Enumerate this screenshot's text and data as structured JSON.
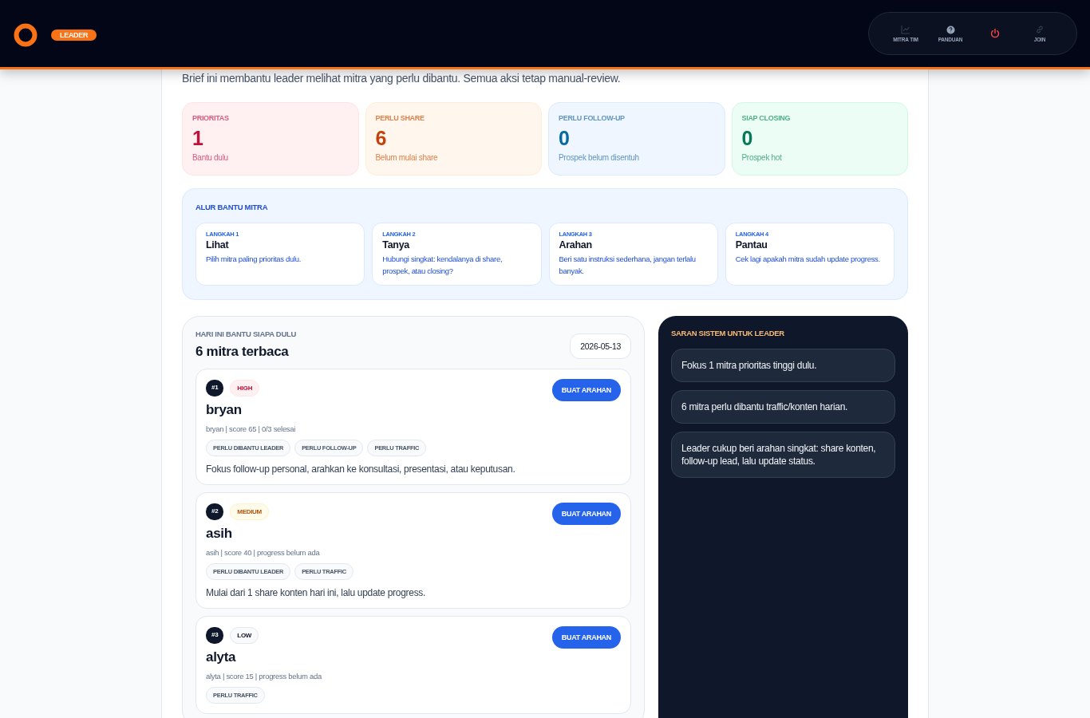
{
  "header": {
    "role_badge": "LEADER",
    "nav": [
      {
        "kind": "chart",
        "label": "MITRA TIM"
      },
      {
        "kind": "help",
        "label": "PANDUAN"
      },
      {
        "kind": "power"
      },
      {
        "kind": "link",
        "label": "JOIN"
      }
    ]
  },
  "brief": "Brief ini membantu leader melihat mitra yang perlu dibantu. Semua aksi tetap manual-review.",
  "stats": [
    {
      "kind": "rose",
      "label": "PRIORITAS",
      "value": "1",
      "note": "Bantu dulu"
    },
    {
      "kind": "orange",
      "label": "PERLU SHARE",
      "value": "6",
      "note": "Belum mulai share"
    },
    {
      "kind": "blue",
      "label": "PERLU FOLLOW-UP",
      "value": "0",
      "note": "Prospek belum disentuh"
    },
    {
      "kind": "green",
      "label": "SIAP CLOSING",
      "value": "0",
      "note": "Prospek hot"
    }
  ],
  "flow": {
    "title": "ALUR BANTU MITRA",
    "steps": [
      {
        "step": "LANGKAH 1",
        "title": "Lihat",
        "text": "Pilih mitra paling prioritas dulu."
      },
      {
        "step": "LANGKAH 2",
        "title": "Tanya",
        "text": "Hubungi singkat: kendalanya di share, prospek, atau closing?"
      },
      {
        "step": "LANGKAH 3",
        "title": "Arahan",
        "text": "Beri satu instruksi sederhana, jangan terlalu banyak."
      },
      {
        "step": "LANGKAH 4",
        "title": "Pantau",
        "text": "Cek lagi apakah mitra sudah update progress."
      }
    ]
  },
  "today": {
    "eyebrow": "HARI INI BANTU SIAPA DULU",
    "title": "6 mitra terbaca",
    "date": "2026-05-13",
    "mitra": [
      {
        "rank": "#1",
        "priority": "HIGH",
        "kind": "high",
        "name": "bryan",
        "meta": "bryan | score 65 | 0/3 selesai",
        "tags": [
          "PERLU DIBANTU LEADER",
          "PERLU FOLLOW-UP",
          "PERLU TRAFFIC"
        ],
        "advice": "Fokus follow-up personal, arahkan ke konsultasi, presentasi, atau keputusan.",
        "action": "BUAT ARAHAN"
      },
      {
        "rank": "#2",
        "priority": "MEDIUM",
        "kind": "medium",
        "name": "asih",
        "meta": "asih | score 40 | progress belum ada",
        "tags": [
          "PERLU DIBANTU LEADER",
          "PERLU TRAFFIC"
        ],
        "advice": "Mulai dari 1 share konten hari ini, lalu update progress.",
        "action": "BUAT ARAHAN"
      },
      {
        "rank": "#3",
        "priority": "LOW",
        "kind": "low",
        "name": "alyta",
        "meta": "alyta | score 15 | progress belum ada",
        "tags": [
          "PERLU TRAFFIC"
        ],
        "action": "BUAT ARAHAN"
      }
    ]
  },
  "suggestions": {
    "title": "SARAN SISTEM UNTUK LEADER",
    "items": [
      "Fokus 1 mitra prioritas tinggi dulu.",
      "6 mitra perlu dibantu traffic/konten harian.",
      "Leader cukup beri arahan singkat: share konten, follow-up lead, lalu update status."
    ]
  }
}
